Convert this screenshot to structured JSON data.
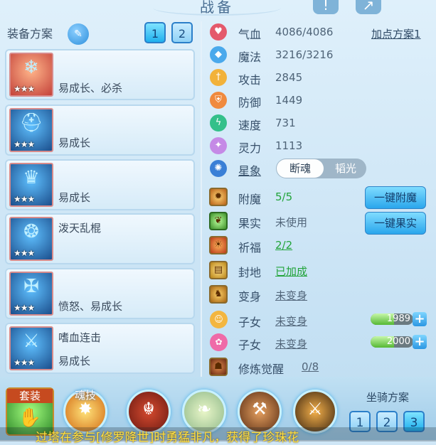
{
  "header": {
    "title": "战备",
    "info_icon": "info-icon",
    "share_icon": "share-icon"
  },
  "left": {
    "heading": "装备方案",
    "scheme_buttons": [
      "1",
      "2"
    ],
    "cards": [
      {
        "name": "",
        "tag": "易成长、必杀",
        "stars": "★★★"
      },
      {
        "name": "",
        "tag": "易成长",
        "stars": "★★★"
      },
      {
        "name": "",
        "tag": "易成长",
        "stars": "★★★"
      },
      {
        "name": "泼天乱棍",
        "tag": "",
        "stars": "★★★"
      },
      {
        "name": "",
        "tag": "愤怒、易成长",
        "stars": "★★★"
      },
      {
        "name": "嗜血连击",
        "tag": "易成长",
        "stars": "★★★"
      }
    ]
  },
  "stats": [
    {
      "label": "气血",
      "value": "4086/4086",
      "color": "#e4596b"
    },
    {
      "label": "魔法",
      "value": "3216/3216",
      "color": "#4aa9ec"
    },
    {
      "label": "攻击",
      "value": "2845",
      "color": "#f2b23a"
    },
    {
      "label": "防御",
      "value": "1449",
      "color": "#f08a3e"
    },
    {
      "label": "速度",
      "value": "731",
      "color": "#34c08a"
    },
    {
      "label": "灵力",
      "value": "1113",
      "color": "#c58ae6"
    }
  ],
  "point_plan_link": "加点方案1",
  "xingxiang": {
    "label": "星象",
    "active": "断魂",
    "inactive": "韬光"
  },
  "rows": {
    "fumo": {
      "label": "附魔",
      "value": "5/5",
      "button": "一键附魔"
    },
    "guoshi": {
      "label": "果实",
      "value": "未使用",
      "button": "一键果实"
    },
    "qifu": {
      "label": "祈福",
      "value": "2/2"
    },
    "fengdi": {
      "label": "封地",
      "value": "已加成"
    },
    "bianshen": {
      "label": "变身",
      "value": "未变身"
    },
    "zinv1": {
      "label": "子女",
      "value": "未变身",
      "bar": "1989"
    },
    "zinv2": {
      "label": "子女",
      "value": "未变身",
      "bar": "2000"
    },
    "xiulian": {
      "label": "修炼觉醒",
      "value": "0/8"
    }
  },
  "bottom": {
    "set_label": "套装",
    "skill_label": "魂技",
    "mount_heading": "坐骑方案",
    "mount_buttons": [
      "1",
      "2",
      "3"
    ],
    "marquee": "过塔在参与[修罗降世]时勇猛非凡，获得了珍珠花"
  }
}
